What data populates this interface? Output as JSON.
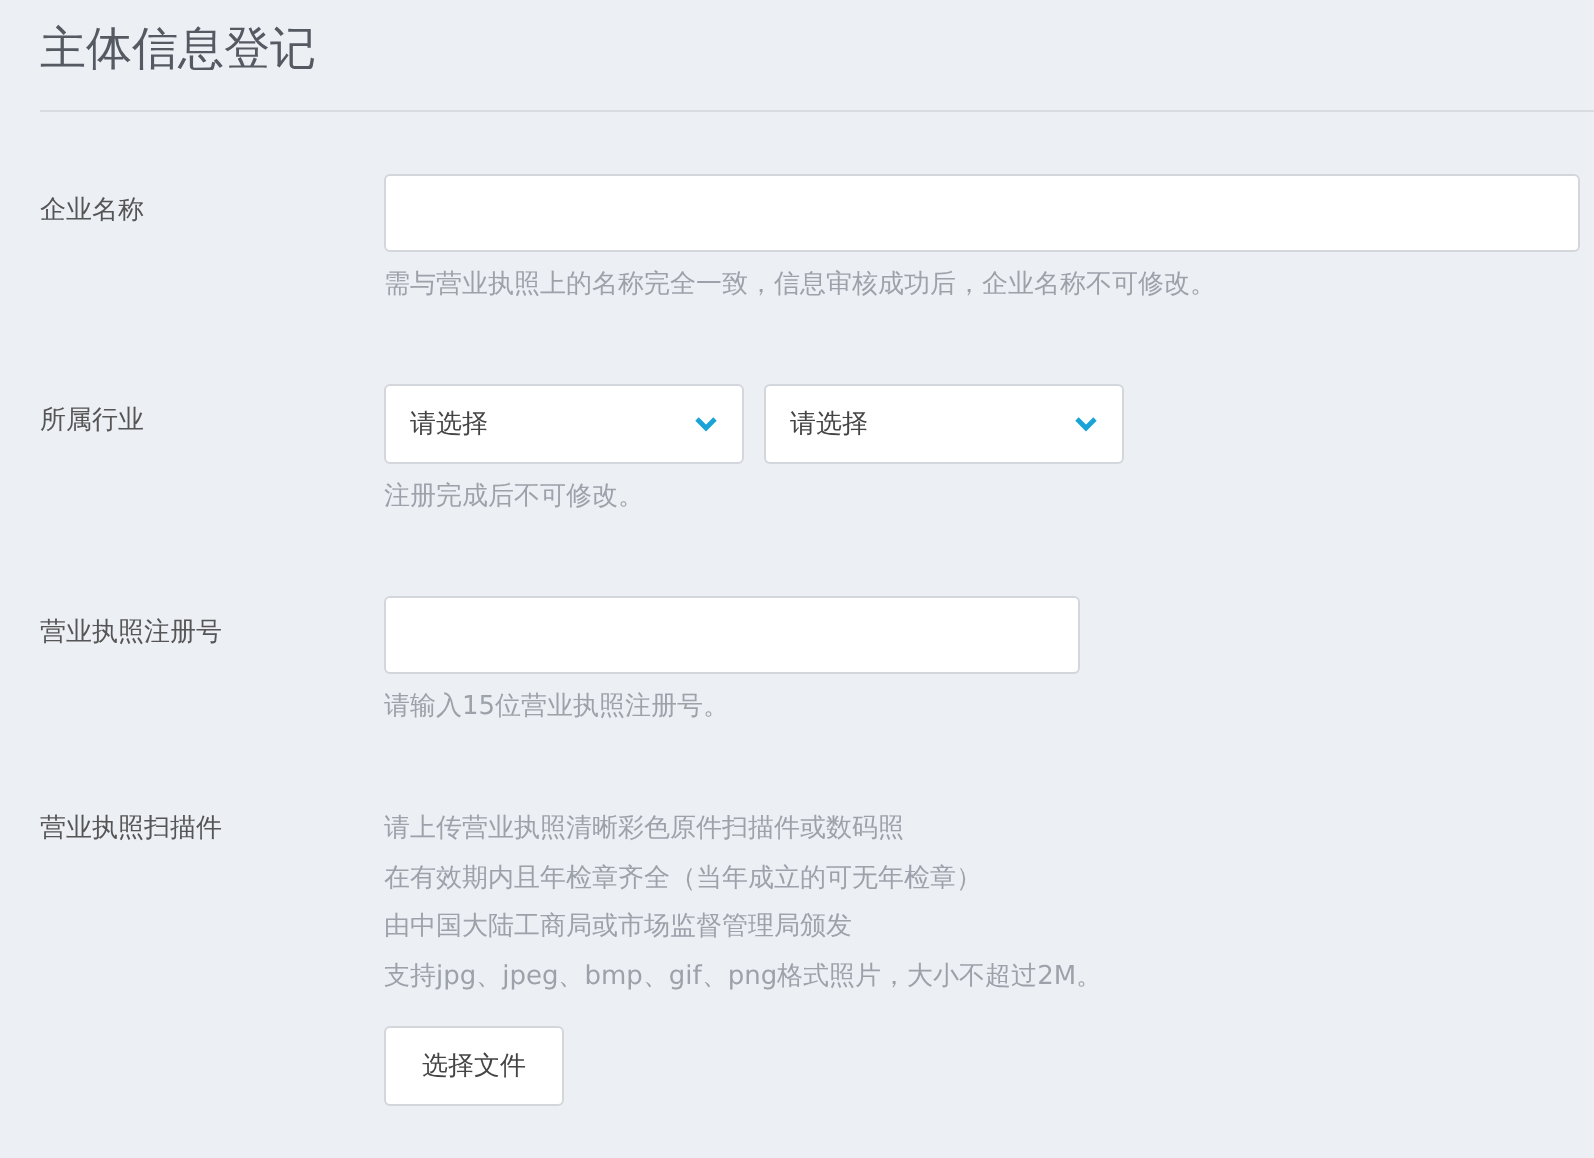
{
  "title": "主体信息登记",
  "fields": [
    {
      "label": "企业名称",
      "kind": "wide_input",
      "hints": [
        "需与营业执照上的名称完全一致，信息审核成功后，企业名称不可修改。"
      ]
    },
    {
      "label": "所属行业",
      "kind": "selects",
      "selects": [
        "请选择",
        "请选择"
      ],
      "hints": [
        "注册完成后不可修改。"
      ]
    },
    {
      "label": "营业执照注册号",
      "kind": "short_input",
      "hints": [
        "请输入15位营业执照注册号。"
      ]
    },
    {
      "label": "营业执照扫描件",
      "kind": "upload",
      "hints": [
        "请上传营业执照清晰彩色原件扫描件或数码照",
        "在有效期内且年检章齐全（当年成立的可无年检章）",
        "由中国大陆工商局或市场监督管理局颁发",
        "支持jpg、jpeg、bmp、gif、png格式照片，大小不超过2M。"
      ],
      "button": "选择文件"
    }
  ]
}
